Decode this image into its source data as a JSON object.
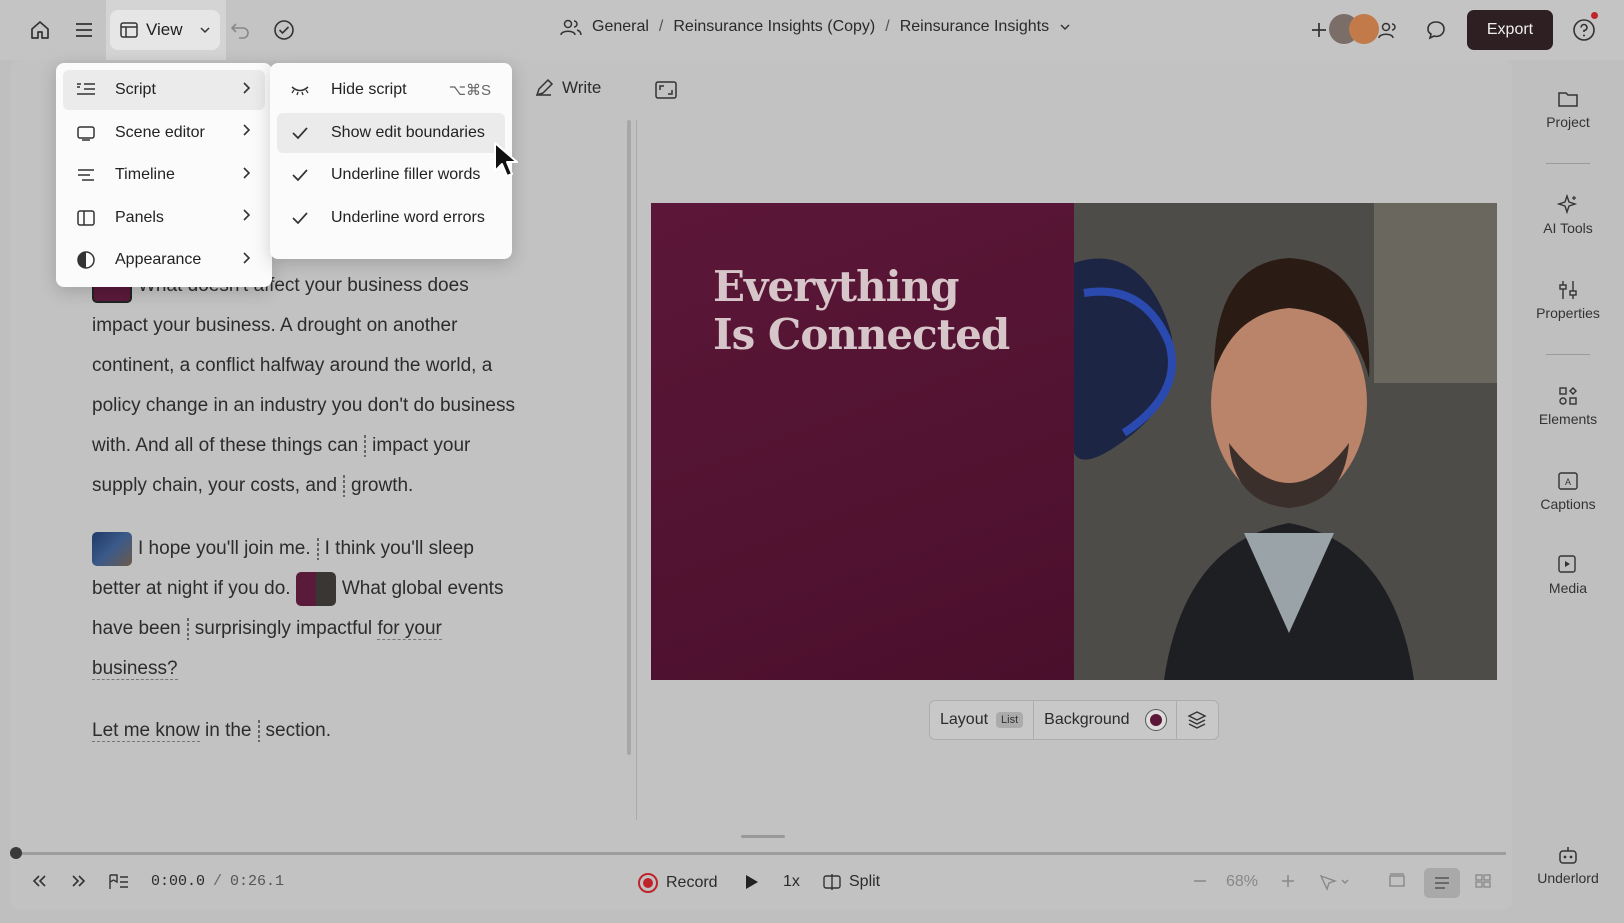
{
  "topbar": {
    "view_label": "View",
    "breadcrumb": {
      "workspace": "General",
      "parent": "Reinsurance Insights (Copy)",
      "current": "Reinsurance Insights"
    },
    "export_label": "Export"
  },
  "view_menu": {
    "items": [
      {
        "label": "Script",
        "icon": "script-icon"
      },
      {
        "label": "Scene editor",
        "icon": "scene-editor-icon"
      },
      {
        "label": "Timeline",
        "icon": "timeline-icon"
      },
      {
        "label": "Panels",
        "icon": "panels-icon"
      },
      {
        "label": "Appearance",
        "icon": "appearance-icon"
      }
    ]
  },
  "script_submenu": {
    "hide_script": {
      "label": "Hide script",
      "shortcut": "⌥⌘S"
    },
    "show_edit_boundaries": "Show edit boundaries",
    "underline_filler_words": "Underline filler words",
    "underline_word_errors": "Underline word errors"
  },
  "script_toolbar": {
    "write_label": "Write"
  },
  "script": {
    "p1": {
      "l1": "What doesn't affect your business does",
      "l2": "impact your business. A drought on another",
      "l3": "continent, a conflict halfway around the world, a",
      "l4": "policy change in an industry you don't do business",
      "l5a": "with. And all of these things can",
      "l5b": "impact your",
      "l6a": "supply chain, your costs, and",
      "l6b": "growth."
    },
    "p2": {
      "a": "I hope you'll join me.",
      "b": "I think you'll sleep",
      "c": "better at night if you do.",
      "d": "What global events",
      "e": "have been",
      "f": "surprisingly impactful",
      "g": "for your",
      "h": "business?"
    },
    "p3": {
      "a": "Let me know",
      "b": "in the",
      "c": "section."
    }
  },
  "preview": {
    "title_line1": "Everything",
    "title_line2": "Is Connected"
  },
  "layout_bar": {
    "layout_label": "Layout",
    "layout_badge": "List",
    "background_label": "Background"
  },
  "right_sidebar": {
    "items": [
      "Project",
      "AI Tools",
      "Properties",
      "Elements",
      "Captions",
      "Media"
    ],
    "underlord": "Underlord"
  },
  "bottombar": {
    "time_current": "0:00.0",
    "time_sep": "/",
    "time_total": "0:26.1",
    "record_label": "Record",
    "speed_label": "1x",
    "split_label": "Split",
    "zoom_label": "68%"
  },
  "colors": {
    "export_bg": "#2d1f22",
    "preview_bg": "#5c1738",
    "record_red": "#c0242b"
  }
}
